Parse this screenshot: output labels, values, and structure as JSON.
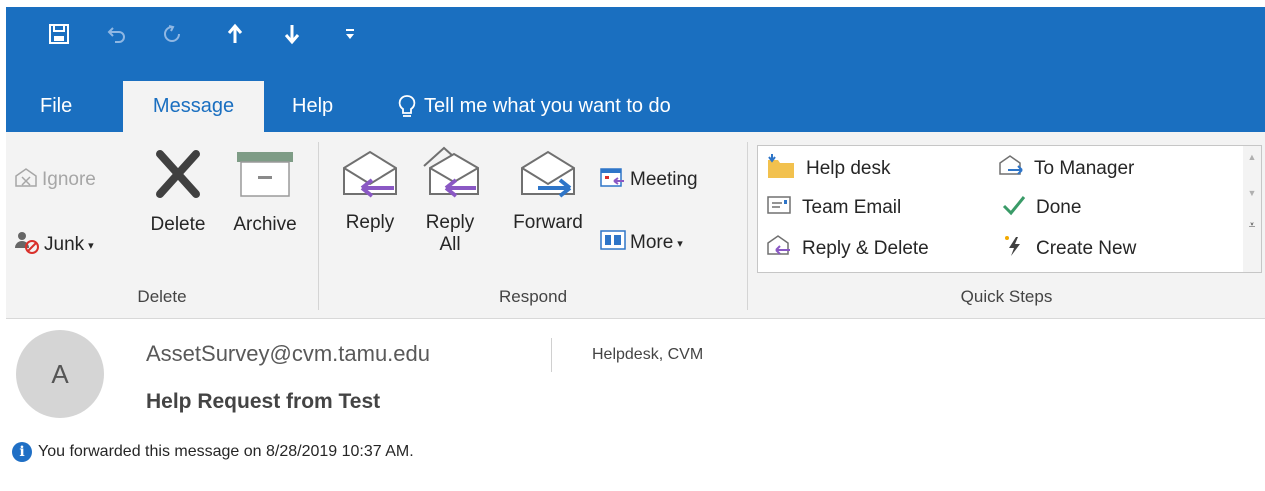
{
  "qat": {
    "icons": [
      "save-icon",
      "undo-icon",
      "redo-icon",
      "previous-item-icon",
      "next-item-icon",
      "customize-qat-icon"
    ]
  },
  "tabs": [
    {
      "label": "File",
      "active": false
    },
    {
      "label": "Message",
      "active": true
    },
    {
      "label": "Help",
      "active": false
    }
  ],
  "tell_me": "Tell me what you want to do",
  "ribbon": {
    "delete_group": {
      "ignore": "Ignore",
      "junk": "Junk",
      "delete": "Delete",
      "archive": "Archive",
      "label": "Delete"
    },
    "respond_group": {
      "reply": "Reply",
      "reply_all_line1": "Reply",
      "reply_all_line2": "All",
      "forward": "Forward",
      "meeting": "Meeting",
      "more": "More",
      "label": "Respond"
    },
    "quick_steps": {
      "items": [
        "Help desk",
        "To Manager",
        "Team Email",
        "Done",
        "Reply & Delete",
        "Create New"
      ],
      "label": "Quick Steps"
    }
  },
  "message": {
    "avatar_initial": "A",
    "from": "AssetSurvey@cvm.tamu.edu",
    "to": "Helpdesk, CVM",
    "subject": "Help Request from Test",
    "info": "You forwarded this message on 8/28/2019 10:37 AM."
  },
  "colors": {
    "accent": "#1a6fc0",
    "ribbon_bg": "#f3f3f3"
  }
}
